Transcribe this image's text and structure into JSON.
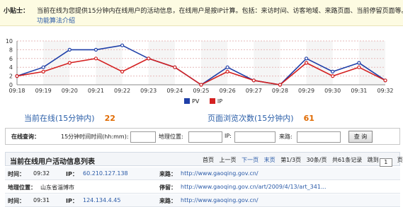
{
  "tips": {
    "label": "小贴士：",
    "text": "当前在线为您提供15分钟内在线用户的活动信息，在线用户是按IP计算。包括：来访时间、访客地域、来路页面、当前停留页面等。",
    "link": "功能算法介绍"
  },
  "chart_data": {
    "type": "line",
    "categories": [
      "09:18",
      "09:19",
      "09:20",
      "09:21",
      "09:22",
      "09:23",
      "09:24",
      "09:25",
      "09:26",
      "09:27",
      "09:28",
      "09:29",
      "09:30",
      "09:31",
      "09:32"
    ],
    "series": [
      {
        "name": "PV",
        "color": "#1f3fa8",
        "values": [
          2,
          4,
          8,
          8,
          9,
          6,
          4,
          0,
          4,
          1,
          0,
          6,
          3,
          5,
          1
        ]
      },
      {
        "name": "IP",
        "color": "#d42020",
        "values": [
          2,
          3,
          5,
          6,
          3,
          6,
          4,
          0,
          3,
          1,
          0,
          5,
          2,
          4,
          1
        ]
      }
    ],
    "ylim": [
      0,
      10
    ],
    "yticks": [
      0,
      2,
      4,
      6,
      8,
      10
    ],
    "grid": true,
    "legend": "bottom"
  },
  "stats": {
    "online_label": "当前在线(15分钟内)",
    "online_value": "22",
    "pv_label": "页面浏览次数(15分钟内)",
    "pv_value": "61"
  },
  "query": {
    "label": "在线查询：",
    "time_label": "15分钟时间时间(hh:mm):",
    "geo_label": "地理位置:",
    "ip_label": "IP:",
    "ref_label": "来路:",
    "button": "查 询"
  },
  "list": {
    "title": "当前在线用户活动信息列表",
    "pager": {
      "first": "首页",
      "prev": "上一页",
      "next": "下一页",
      "last": "末页",
      "page": "第1/3页",
      "per_page": "30条/页",
      "total": "共61条记录",
      "jump": "跳到",
      "jump_value": "1",
      "jump_unit": "页"
    },
    "rows": [
      {
        "k1": "时间：",
        "v1": "09:32",
        "k2": "IP：",
        "v2": "60.210.127.138",
        "k3": "来路：",
        "v3": "http://www.gaoqing.gov.cn/"
      },
      {
        "k1": "地理位置：",
        "v1": "山东省淄博市",
        "k2": "",
        "v2": "",
        "k3": "停留：",
        "v3": "http://www.gaoqing.gov.cn/art/2009/4/13/art_341..."
      },
      {
        "k1": "时间：",
        "v1": "09:31",
        "k2": "IP：",
        "v2": "124.134.4.45",
        "k3": "来路：",
        "v3": "http://www.gaoqing.gov.cn/"
      }
    ]
  }
}
